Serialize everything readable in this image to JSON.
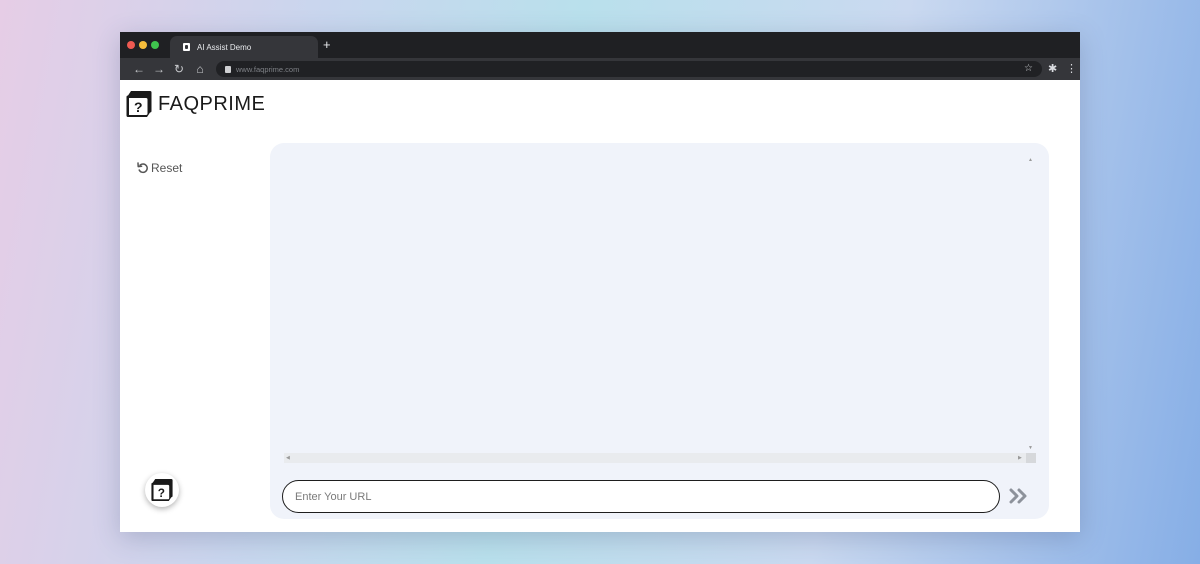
{
  "browser": {
    "tab_title": "AI Assist Demo",
    "new_tab_label": "+",
    "url": "www.faqprime.com",
    "icons": {
      "back": "back-arrow-icon",
      "forward": "forward-arrow-icon",
      "reload": "reload-icon",
      "home": "home-icon",
      "bookmark": "star-icon",
      "extensions": "puzzle-icon",
      "menu": "kebab-menu-icon"
    }
  },
  "app": {
    "brand": "FAQPRIME",
    "reset_label": "Reset",
    "url_input": {
      "placeholder": "Enter Your URL",
      "value": ""
    },
    "colors": {
      "panel_bg": "#f0f3fa",
      "input_border": "#1e1e1e",
      "send_icon": "#8d929b"
    }
  }
}
